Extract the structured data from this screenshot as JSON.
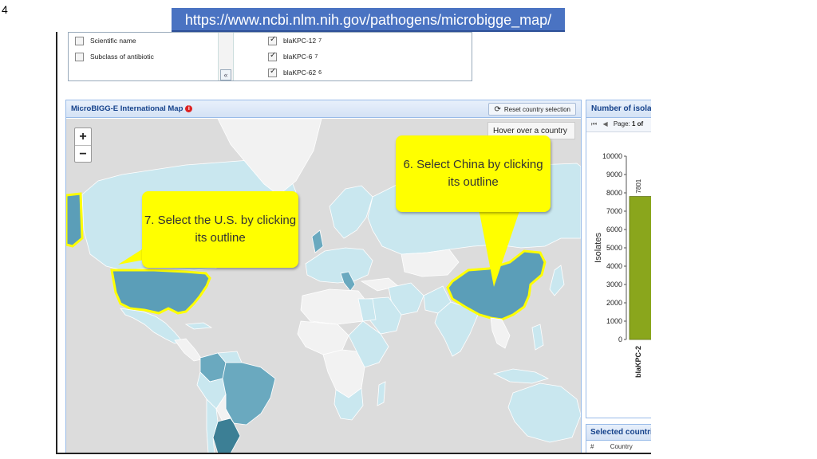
{
  "slide": {
    "number": "4"
  },
  "url_banner": "https://www.ncbi.nlm.nih.gov/pathogens/microbigge_map/",
  "filters": {
    "left_items": [
      {
        "label": "Scientific name",
        "checked": false
      },
      {
        "label": "Subclass of antibiotic",
        "checked": false
      }
    ],
    "collapse_label": "«",
    "right_items": [
      {
        "label": "blaKPC-12",
        "count": "7",
        "checked": true
      },
      {
        "label": "blaKPC-6",
        "count": "7",
        "checked": true
      },
      {
        "label": "blaKPC-62",
        "count": "6",
        "checked": true
      }
    ]
  },
  "map": {
    "title": "MicroBIGG-E International Map",
    "info_glyph": "i",
    "reset_label": "Reset country selection",
    "zoom_in": "+",
    "zoom_out": "−",
    "hover_tip": "Hover over a country"
  },
  "callouts": {
    "china": "6. Select China by clicking its outline",
    "usa": "7. Select the U.S. by clicking its outline"
  },
  "side_panel": {
    "title": "Number of isolates",
    "pager_label": "Page:",
    "pager_value": "1 of",
    "chart_data": {
      "type": "bar",
      "categories": [
        "blaKPC-2"
      ],
      "values": [
        7801
      ],
      "ylabel": "Isolates",
      "ylim": [
        0,
        10000
      ],
      "yticks": [
        "0",
        "1000",
        "2000",
        "3000",
        "4000",
        "5000",
        "6000",
        "7000",
        "8000",
        "9000",
        "10000"
      ],
      "data_labels": [
        "7801"
      ],
      "bar_color": "#8aa61c"
    }
  },
  "selected_panel": {
    "title": "Selected countries",
    "col_hash": "#",
    "col_country": "Country"
  },
  "colors": {
    "selected_country": "#5b9eb8",
    "selected_outline": "#ffff00",
    "light_country": "#c9e7ef",
    "medium_country": "#6aa9bf",
    "dark_country": "#3c7f95",
    "no_data_country": "#f2f2f2",
    "ocean": "#dcdcdc",
    "callout": "#ffff00"
  }
}
